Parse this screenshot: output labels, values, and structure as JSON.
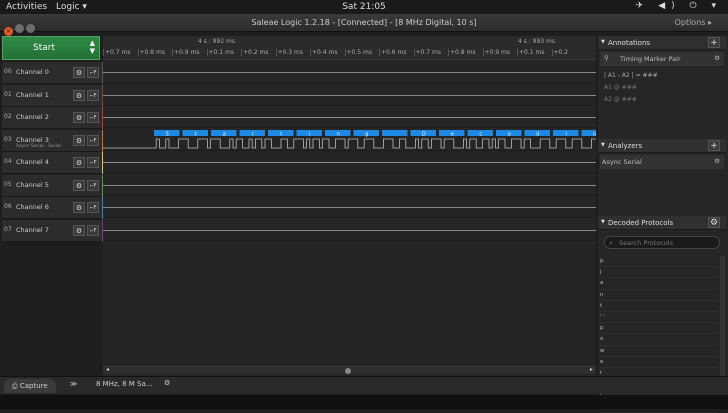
{
  "system": {
    "activities": "Activities",
    "app_menu": "Logic ▾",
    "clock": "Sat 21:05",
    "tray": "✈ ◀) ⏻ ▾"
  },
  "window": {
    "title": "Saleae Logic 1.2.18 - [Connected] - [8 MHz Digital, 10 s]",
    "options": "Options ▸"
  },
  "start_button": "Start",
  "channels": [
    {
      "num": "00",
      "name": "Channel 0",
      "sub": "",
      "color": "#555555"
    },
    {
      "num": "01",
      "name": "Channel 1",
      "sub": "",
      "color": "#8b4513"
    },
    {
      "num": "02",
      "name": "Channel 2",
      "sub": "",
      "color": "#d32f2f"
    },
    {
      "num": "03",
      "name": "Channel 3",
      "sub": "Async Serial - Serial",
      "color": "#ef6c00"
    },
    {
      "num": "04",
      "name": "Channel 4",
      "sub": "",
      "color": "#fbc02d"
    },
    {
      "num": "05",
      "name": "Channel 5",
      "sub": "",
      "color": "#43a047"
    },
    {
      "num": "06",
      "name": "Channel 6",
      "sub": "",
      "color": "#1e88e5"
    },
    {
      "num": "07",
      "name": "Channel 7",
      "sub": "",
      "color": "#8e24aa"
    }
  ],
  "ruler": {
    "top_left": "4 s : 992 ms",
    "top_right": "4 s : 993 ms",
    "ticks": [
      "+0.7 ms",
      "+0.8 ms",
      "+0.9 ms",
      "+0.1 ms",
      "+0.2 ms",
      "+0.3 ms",
      "+0.4 ms",
      "+0.5 ms",
      "+0.6 ms",
      "+0.7 ms",
      "+0.8 ms",
      "+0.9 ms",
      "+0.1 ms",
      "+0.2"
    ]
  },
  "decoded_chars": [
    "S",
    "t",
    "a",
    "r",
    "t",
    "i",
    "n",
    "g",
    " ",
    "D",
    "e",
    "c",
    "o",
    "d",
    "i",
    "n",
    "g",
    " "
  ],
  "panels": {
    "annotations": "Annotations",
    "timing_marker": "Timing Marker Pair",
    "a1_a2": "| A1 - A2 | = ###",
    "a1": "A1  @  ###",
    "a2": "A2  @  ###",
    "analyzers": "Analyzers",
    "analyzer_item": "Async Serial",
    "decoded": "Decoded Protocols",
    "search_placeholder": "Search Protocols",
    "decoded_list": [
      "p",
      "j",
      "a",
      "n",
      "t",
      "' '",
      "p",
      "o",
      "w",
      "e",
      "r",
      "' '",
      "i",
      "s"
    ]
  },
  "bottom": {
    "tab": "Capture",
    "info": "8 MHz, 8 M Sa..."
  }
}
